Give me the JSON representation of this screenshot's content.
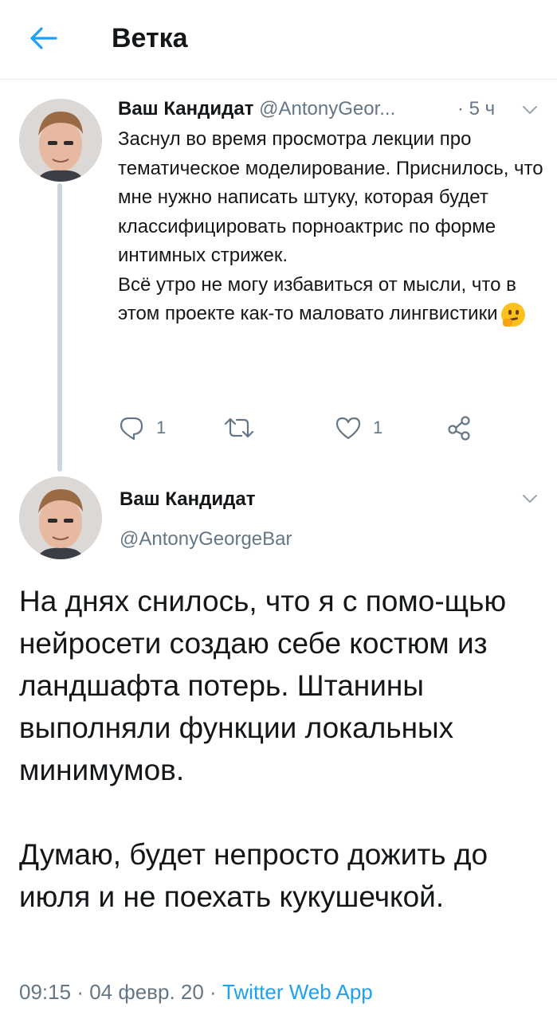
{
  "header": {
    "title": "Ветка"
  },
  "thread": [
    {
      "name": "Ваш Кандидат",
      "handle": "@AntonyGeor...",
      "time": "· 5 ч",
      "body": [
        "Заснул во время просмотра лекции про тематическое моделирование. Приснилось, что мне нужно написать штуку, которая будет классифицировать порноактрис по форме интимных стрижек.",
        "Всё утро не могу избавиться от мысли, что в этом проекте как-то маловато лингвистики"
      ],
      "emoji": "thinking-face",
      "actions": {
        "reply_count": "1",
        "like_count": "1"
      }
    }
  ],
  "focused_tweet": {
    "name": "Ваш Кандидат",
    "handle": "@AntonyGeorgeBar",
    "body": [
      "На днях снилось, что я с помо-щью нейросети создаю себе костюм из ландшафта потерь. Штанины выполняли функции локальных минимумов.",
      "Думаю, будет непросто дожить до июля и не поехать кукушечкой."
    ],
    "meta": {
      "time": "09:15",
      "date": "04 февр. 20",
      "app": "Twitter Web App",
      "separator": " · "
    }
  },
  "colors": {
    "accent": "#1da1f2",
    "secondary_text": "#657786",
    "primary_text": "#14171a"
  }
}
